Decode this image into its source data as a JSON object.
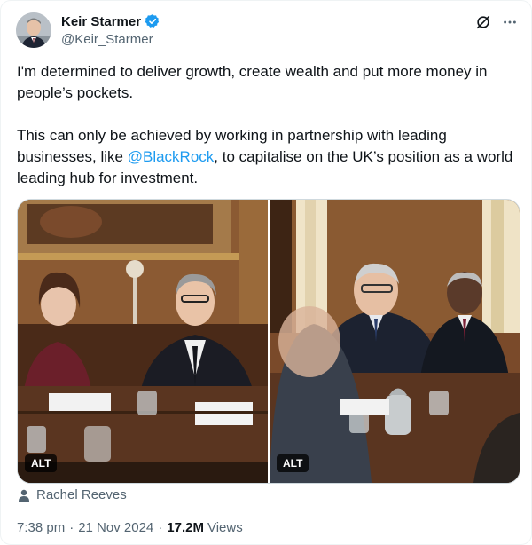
{
  "author": {
    "name": "Keir Starmer",
    "handle": "@Keir_Starmer",
    "verified": true
  },
  "tweet": {
    "text_line1": "I'm determined to deliver growth, create wealth and put more money in people’s pockets.",
    "text_line2_pre": "This can only be achieved by working in partnership with leading businesses, like ",
    "mention": "@BlackRock",
    "text_line2_post": ", to capitalise on the UK’s position as a world leading hub for investment."
  },
  "media": {
    "photos": [
      {
        "alt_label": "ALT"
      },
      {
        "alt_label": "ALT"
      }
    ]
  },
  "tagged": {
    "name": "Rachel Reeves",
    "icon": "person-icon"
  },
  "meta": {
    "time": "7:38 pm",
    "date": "21 Nov 2024",
    "views_count": "17.2M",
    "views_label": "Views"
  },
  "icons": {
    "verified": "verified-badge-icon",
    "grok": "grok-icon",
    "more": "more-icon"
  },
  "colors": {
    "link": "#1d9bf0",
    "secondary_text": "#536471",
    "verified": "#1d9bf0"
  }
}
